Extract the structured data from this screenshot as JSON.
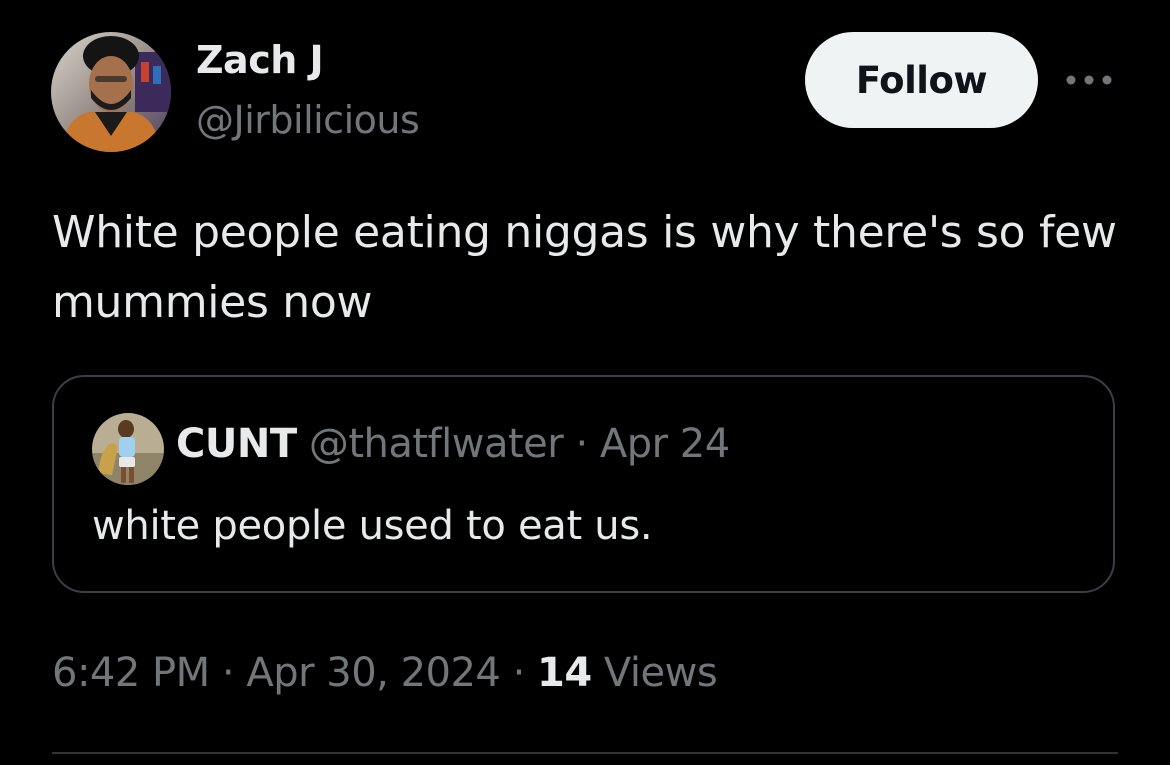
{
  "tweet": {
    "author": {
      "name": "Zach J",
      "handle": "@Jirbilicious"
    },
    "follow_label": "Follow",
    "more_icon": "ellipsis-icon",
    "text": "White people eating niggas is why there's so few mummies now",
    "quoted": {
      "name": "CUNT",
      "handle": "@thatflwater",
      "separator": "·",
      "date": "Apr 24",
      "text": "white people used to eat us."
    },
    "meta": {
      "time": "6:42 PM",
      "separator": "·",
      "date": "Apr 30, 2024",
      "views_count": "14",
      "views_label": "Views"
    }
  },
  "colors": {
    "background": "#000000",
    "primary_text": "#e7e9ea",
    "secondary_text": "#71767b",
    "border": "#3b3f44",
    "follow_bg": "#eff3f4"
  }
}
